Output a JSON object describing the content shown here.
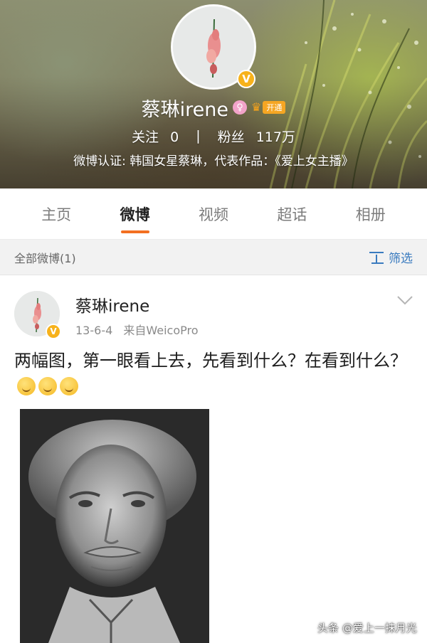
{
  "profile": {
    "name": "蔡琳irene",
    "vip_label": "开通",
    "following_label": "关注",
    "following_count": "0",
    "divider": "|",
    "followers_label": "粉丝",
    "followers_count": "117万",
    "verification": "微博认证: 韩国女星蔡琳，代表作品：《爱上女主播》"
  },
  "tabs": [
    {
      "label": "主页",
      "active": false
    },
    {
      "label": "微博",
      "active": true
    },
    {
      "label": "视频",
      "active": false
    },
    {
      "label": "超话",
      "active": false
    },
    {
      "label": "相册",
      "active": false
    }
  ],
  "filter_bar": {
    "count_label": "全部微博(1)",
    "filter_label": "筛选"
  },
  "post": {
    "author": "蔡琳irene",
    "date": "13-6-4",
    "source": "来自WeicoPro",
    "text": "两幅图，第一眼看上去，先看到什么？在看到什么？"
  },
  "watermark": "头条 @爱上一抹月光",
  "colors": {
    "accent": "#f36f21",
    "link": "#3a7bbf",
    "verified": "#f7b21b"
  }
}
